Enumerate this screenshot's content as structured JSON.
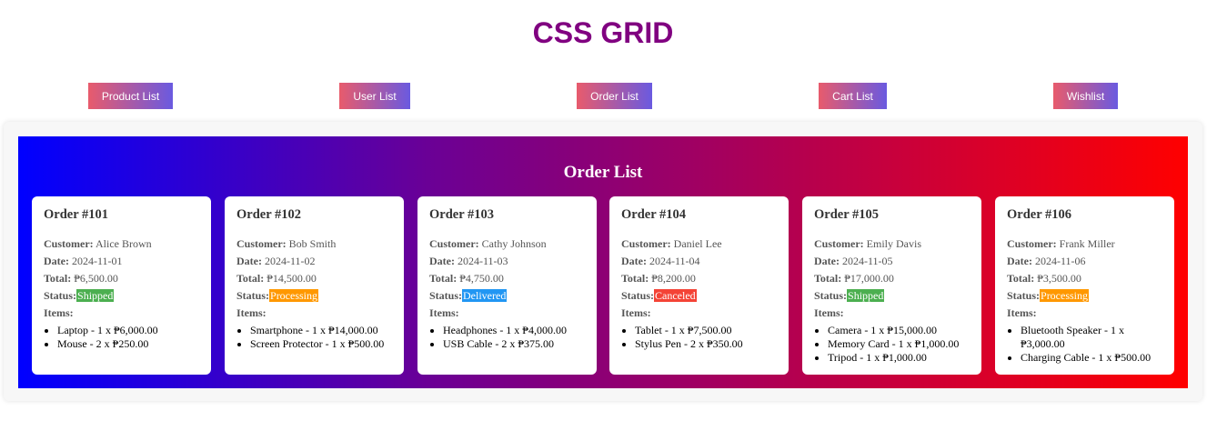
{
  "page_title": "CSS GRID",
  "nav": [
    {
      "label": "Product List"
    },
    {
      "label": "User List"
    },
    {
      "label": "Order List"
    },
    {
      "label": "Cart List"
    },
    {
      "label": "Wishlist"
    }
  ],
  "section_title": "Order List",
  "labels": {
    "customer": "Customer:",
    "date": "Date:",
    "total": "Total:",
    "status": "Status:",
    "items": "Items:"
  },
  "status_colors": {
    "Shipped": "#4caf50",
    "Processing": "#ff9800",
    "Delivered": "#2196f3",
    "Canceled": "#f44336"
  },
  "orders": [
    {
      "title": "Order #101",
      "customer": "Alice Brown",
      "date": "2024-11-01",
      "total": "₱6,500.00",
      "status": "Shipped",
      "items": [
        "Laptop - 1 x ₱6,000.00",
        "Mouse - 2 x ₱250.00"
      ]
    },
    {
      "title": "Order #102",
      "customer": "Bob Smith",
      "date": "2024-11-02",
      "total": "₱14,500.00",
      "status": "Processing",
      "items": [
        "Smartphone - 1 x ₱14,000.00",
        "Screen Protector - 1 x ₱500.00"
      ]
    },
    {
      "title": "Order #103",
      "customer": "Cathy Johnson",
      "date": "2024-11-03",
      "total": "₱4,750.00",
      "status": "Delivered",
      "items": [
        "Headphones - 1 x ₱4,000.00",
        "USB Cable - 2 x ₱375.00"
      ]
    },
    {
      "title": "Order #104",
      "customer": "Daniel Lee",
      "date": "2024-11-04",
      "total": "₱8,200.00",
      "status": "Canceled",
      "items": [
        "Tablet - 1 x ₱7,500.00",
        "Stylus Pen - 2 x ₱350.00"
      ]
    },
    {
      "title": "Order #105",
      "customer": "Emily Davis",
      "date": "2024-11-05",
      "total": "₱17,000.00",
      "status": "Shipped",
      "items": [
        "Camera - 1 x ₱15,000.00",
        "Memory Card - 1 x ₱1,000.00",
        "Tripod - 1 x ₱1,000.00"
      ]
    },
    {
      "title": "Order #106",
      "customer": "Frank Miller",
      "date": "2024-11-06",
      "total": "₱3,500.00",
      "status": "Processing",
      "items": [
        "Bluetooth Speaker - 1 x ₱3,000.00",
        "Charging Cable - 1 x ₱500.00"
      ]
    }
  ]
}
